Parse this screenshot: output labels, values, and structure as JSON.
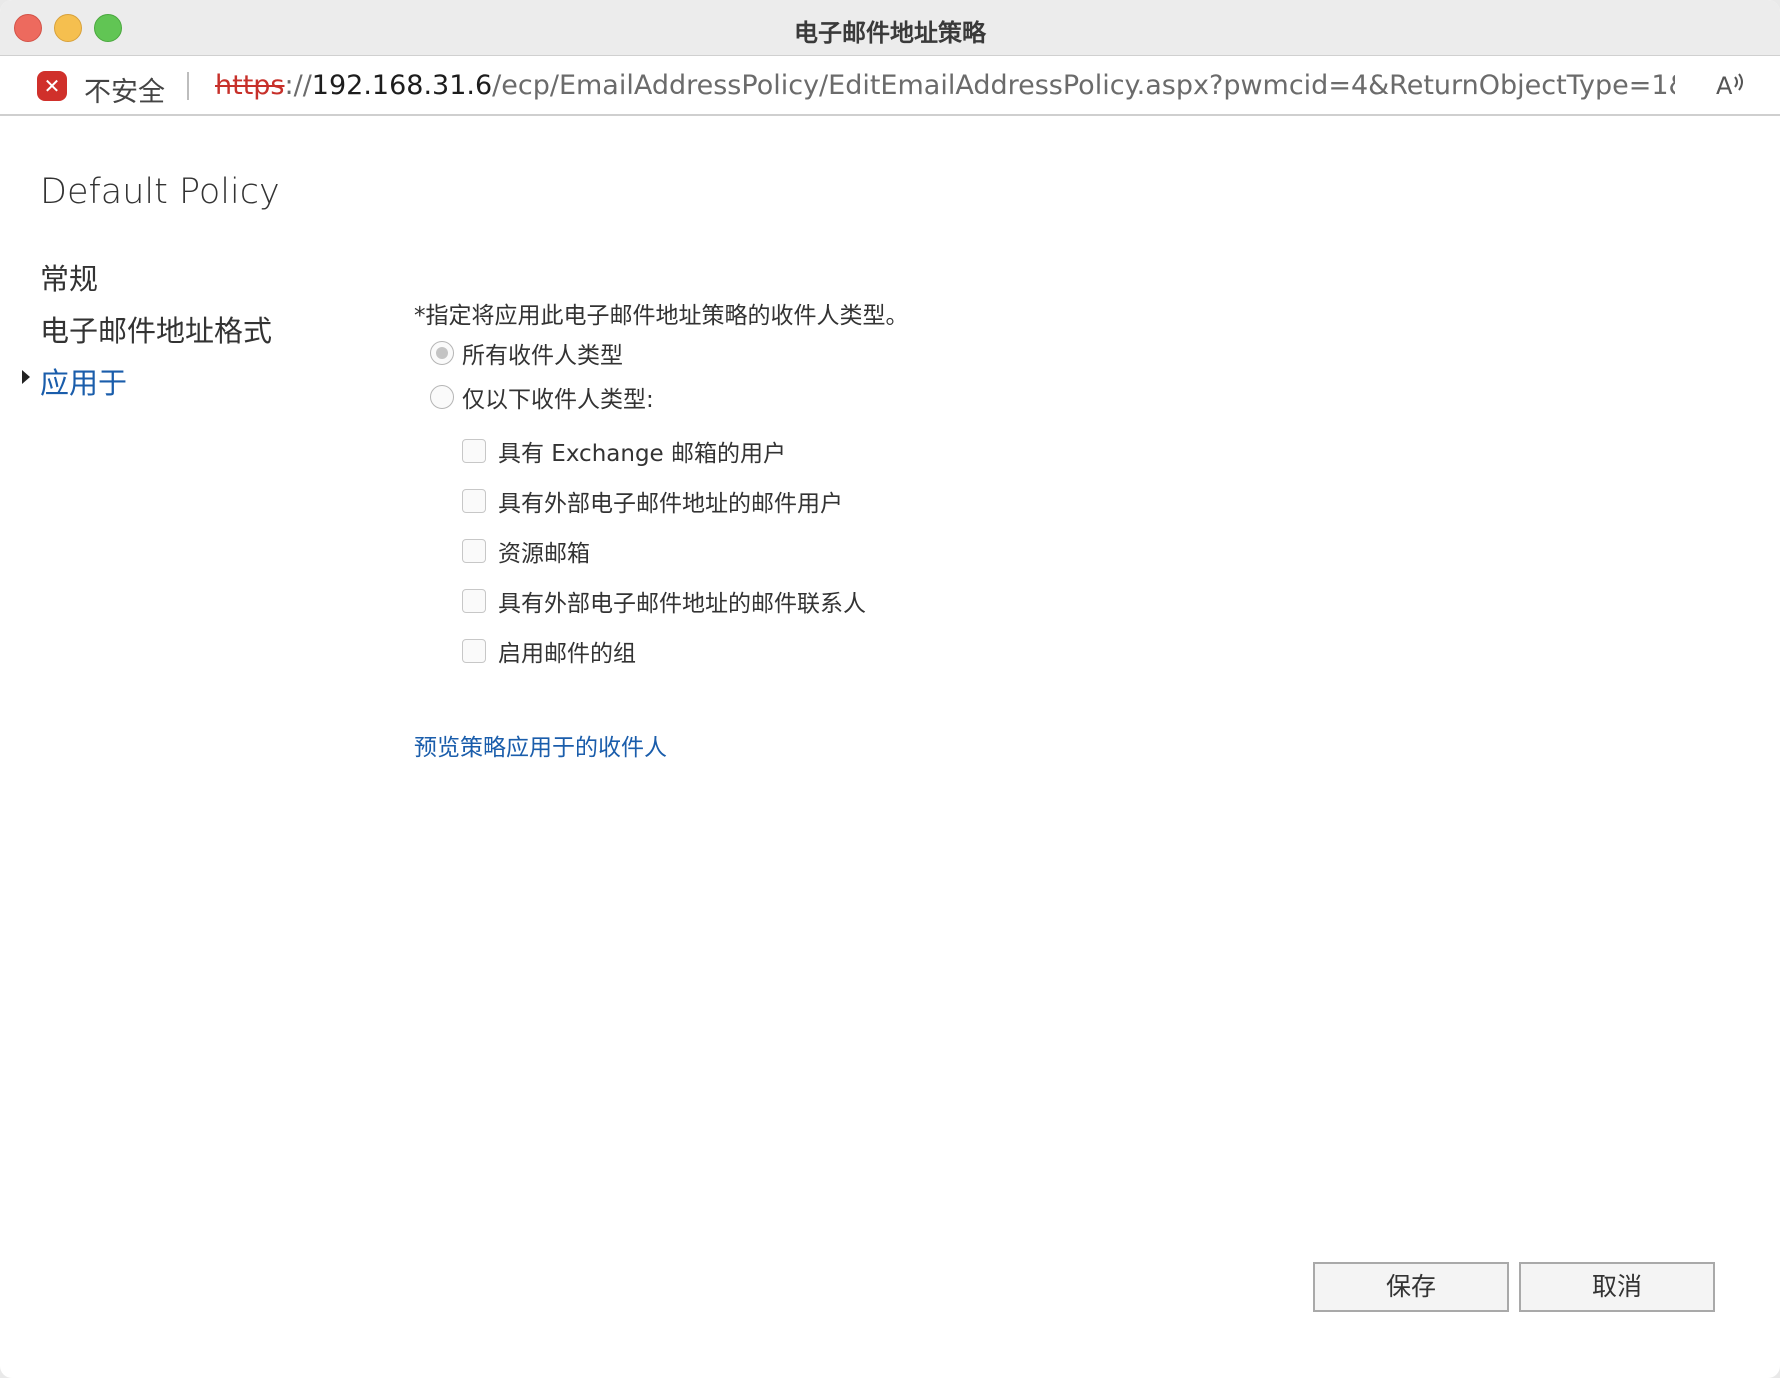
{
  "window": {
    "title": "电子邮件地址策略"
  },
  "address_bar": {
    "security_text": "不安全",
    "url_scheme": "https",
    "url_separator": "://",
    "url_host": "192.168.31.6",
    "url_path": "/ecp/EmailAddressPolicy/EditEmailAddressPolicy.aspx?pwmcid=4&ReturnObjectType=1&..."
  },
  "page": {
    "title": "Default Policy"
  },
  "nav": {
    "items": [
      {
        "label": "常规"
      },
      {
        "label": "电子邮件地址格式"
      },
      {
        "label": "应用于"
      }
    ],
    "active_index": 2
  },
  "form": {
    "instruction": "*指定将应用此电子邮件地址策略的收件人类型。",
    "radio_all": {
      "label": "所有收件人类型",
      "checked": true
    },
    "radio_only": {
      "label": "仅以下收件人类型:",
      "checked": false
    },
    "checkboxes": [
      {
        "label": "具有 Exchange 邮箱的用户",
        "checked": false
      },
      {
        "label": "具有外部电子邮件地址的邮件用户",
        "checked": false
      },
      {
        "label": "资源邮箱",
        "checked": false
      },
      {
        "label": "具有外部电子邮件地址的邮件联系人",
        "checked": false
      },
      {
        "label": "启用邮件的组",
        "checked": false
      }
    ],
    "preview_link": "预览策略应用于的收件人"
  },
  "buttons": {
    "save": "保存",
    "cancel": "取消"
  },
  "colors": {
    "accent_link": "#1a5dab",
    "insecure_red": "#d0302b"
  }
}
